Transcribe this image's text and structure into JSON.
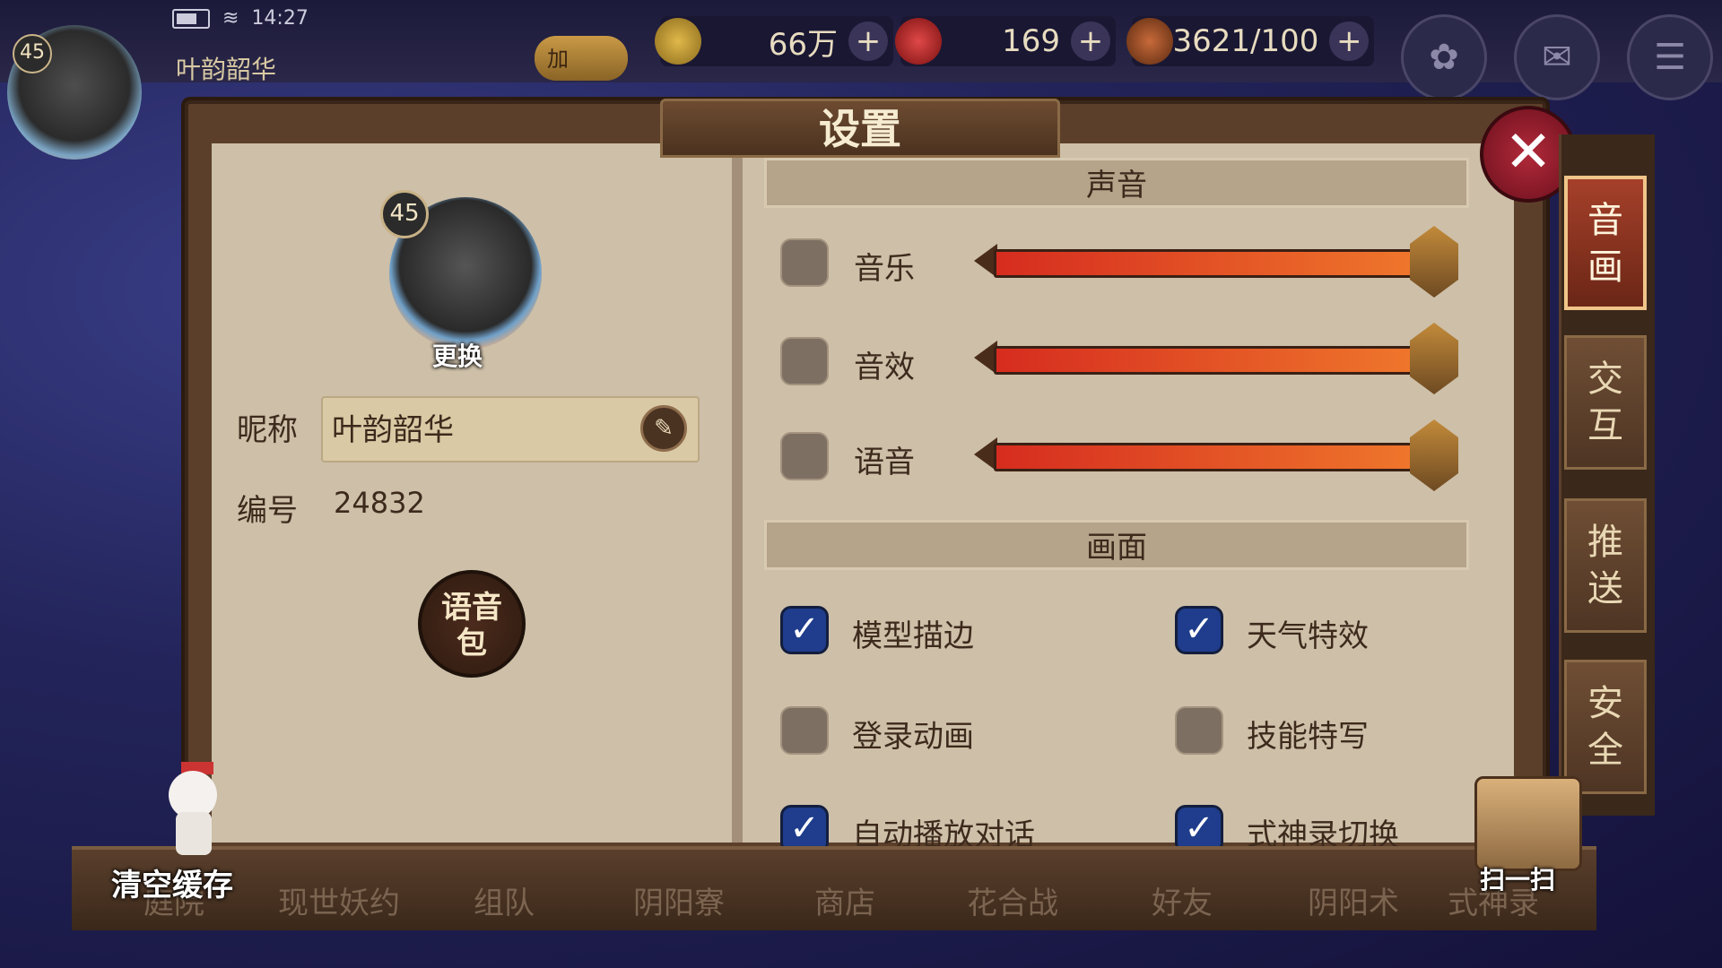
{
  "status": {
    "time": "14:27"
  },
  "player": {
    "level": "45",
    "name": "叶韵韶华",
    "id": "24832"
  },
  "topbar": {
    "buff_label": "加",
    "coins": "66万",
    "jade": "169",
    "stamina": "3621/100",
    "plus": "+"
  },
  "settings": {
    "title": "设置",
    "change_avatar": "更换",
    "nickname_label": "昵称",
    "id_label": "编号",
    "voice_pack": "语音包",
    "sound_section": "声音",
    "sound_rows": [
      {
        "label": "音乐",
        "enabled": false,
        "volume": 1.0
      },
      {
        "label": "音效",
        "enabled": false,
        "volume": 1.0
      },
      {
        "label": "语音",
        "enabled": false,
        "volume": 1.0
      }
    ],
    "graphics_section": "画面",
    "graphics_options": [
      {
        "label": "模型描边",
        "checked": true
      },
      {
        "label": "天气特效",
        "checked": true
      },
      {
        "label": "登录动画",
        "checked": false
      },
      {
        "label": "技能特写",
        "checked": false
      },
      {
        "label": "自动播放对话",
        "checked": true
      },
      {
        "label": "式神录切换",
        "checked": true
      }
    ],
    "check_mark": "✓"
  },
  "tabs": [
    {
      "label": "音画",
      "active": true
    },
    {
      "label": "交互",
      "active": false
    },
    {
      "label": "推送",
      "active": false
    },
    {
      "label": "安全",
      "active": false
    }
  ],
  "bottom": {
    "clear_cache": "清空缓存",
    "scan": "扫一扫",
    "nav": [
      "庭院",
      "现世妖约",
      "组队",
      "阴阳寮",
      "商店",
      "花合战",
      "好友",
      "阴阳术",
      "式神录"
    ]
  },
  "icons": {
    "close": "✕",
    "edit": "✎",
    "top_right_1": "✿",
    "top_right_2": "✉",
    "top_right_3": "☰"
  },
  "colors": {
    "slider_start": "#d62c1f",
    "slider_end": "#f07a2c",
    "checkbox_on": "#1f3d8c",
    "active_tab": "#a5402a"
  }
}
